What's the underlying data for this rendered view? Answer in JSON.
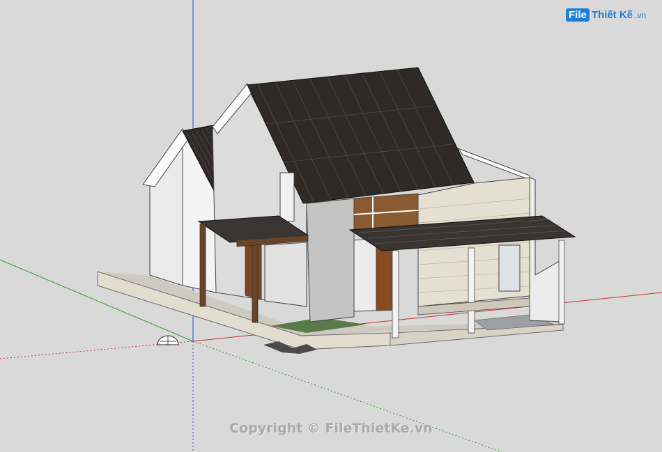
{
  "brand": {
    "logo_box": "File",
    "logo_text": "Thiết Kế",
    "logo_ext": ".vn"
  },
  "watermark": "Copyright © FileThietKe.vn",
  "scene": {
    "background": "#d9d9d9",
    "roof_color": "#2f2a27",
    "wall_color": "#f2f2f2",
    "stone_color": "#e3ddd0"
  }
}
